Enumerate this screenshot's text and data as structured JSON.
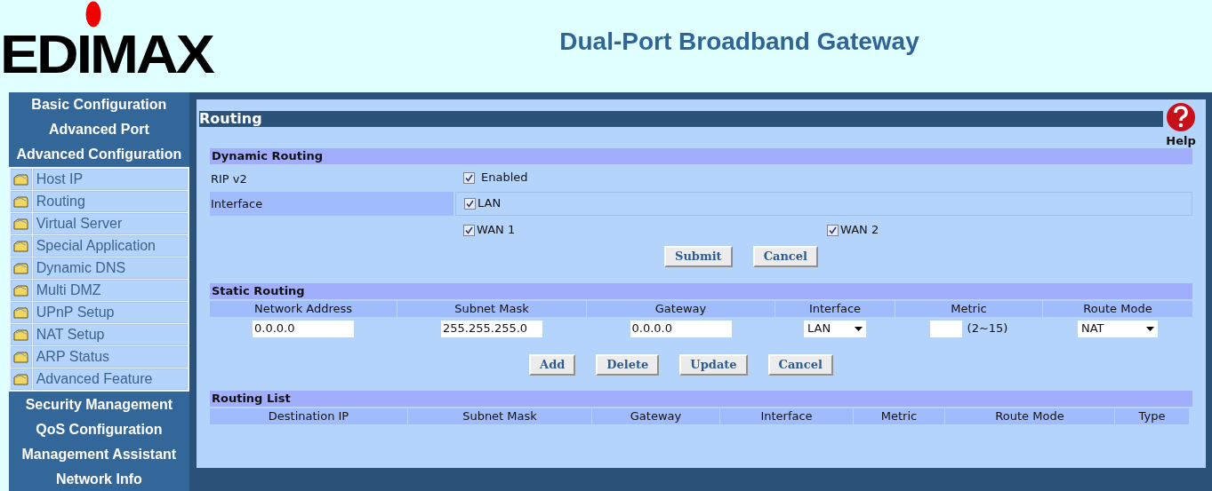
{
  "header": {
    "logo": "EDIMAX",
    "title": "Dual-Port Broadband Gateway"
  },
  "sidebar": {
    "items": [
      {
        "label": "Basic Configuration"
      },
      {
        "label": "Advanced Port"
      },
      {
        "label": "Advanced Configuration",
        "children": [
          {
            "label": "Host IP"
          },
          {
            "label": "Routing"
          },
          {
            "label": "Virtual Server"
          },
          {
            "label": "Special Application"
          },
          {
            "label": "Dynamic DNS"
          },
          {
            "label": "Multi DMZ"
          },
          {
            "label": "UPnP Setup"
          },
          {
            "label": "NAT Setup"
          },
          {
            "label": "ARP Status"
          },
          {
            "label": "Advanced Feature"
          }
        ]
      },
      {
        "label": "Security Management"
      },
      {
        "label": "QoS Configuration"
      },
      {
        "label": "Management Assistant"
      },
      {
        "label": "Network Info"
      }
    ]
  },
  "page": {
    "title": "Routing",
    "help": "Help"
  },
  "dynamic_routing": {
    "title": "Dynamic Routing",
    "rip": {
      "label": "RIP v2",
      "option": "Enabled",
      "checked": true
    },
    "interface": {
      "label": "Interface",
      "options": [
        {
          "label": "LAN",
          "checked": true
        },
        {
          "label": "WAN 1",
          "checked": true
        },
        {
          "label": "WAN 2",
          "checked": true
        }
      ]
    },
    "buttons": [
      "Submit",
      "Cancel"
    ]
  },
  "static_routing": {
    "title": "Static Routing",
    "columns": [
      "Network Address",
      "Subnet Mask",
      "Gateway",
      "Interface",
      "Metric",
      "Route Mode"
    ],
    "network_address": "0.0.0.0",
    "subnet_mask": "255.255.255.0",
    "gateway": "0.0.0.0",
    "interface": "LAN",
    "metric_hint": "(2~15)",
    "route_mode": "NAT",
    "buttons": [
      "Add",
      "Delete",
      "Update",
      "Cancel"
    ]
  },
  "routing_list": {
    "title": "Routing List",
    "columns": [
      "Destination IP",
      "Subnet Mask",
      "Gateway",
      "Interface",
      "Metric",
      "Route Mode",
      "Type"
    ]
  }
}
